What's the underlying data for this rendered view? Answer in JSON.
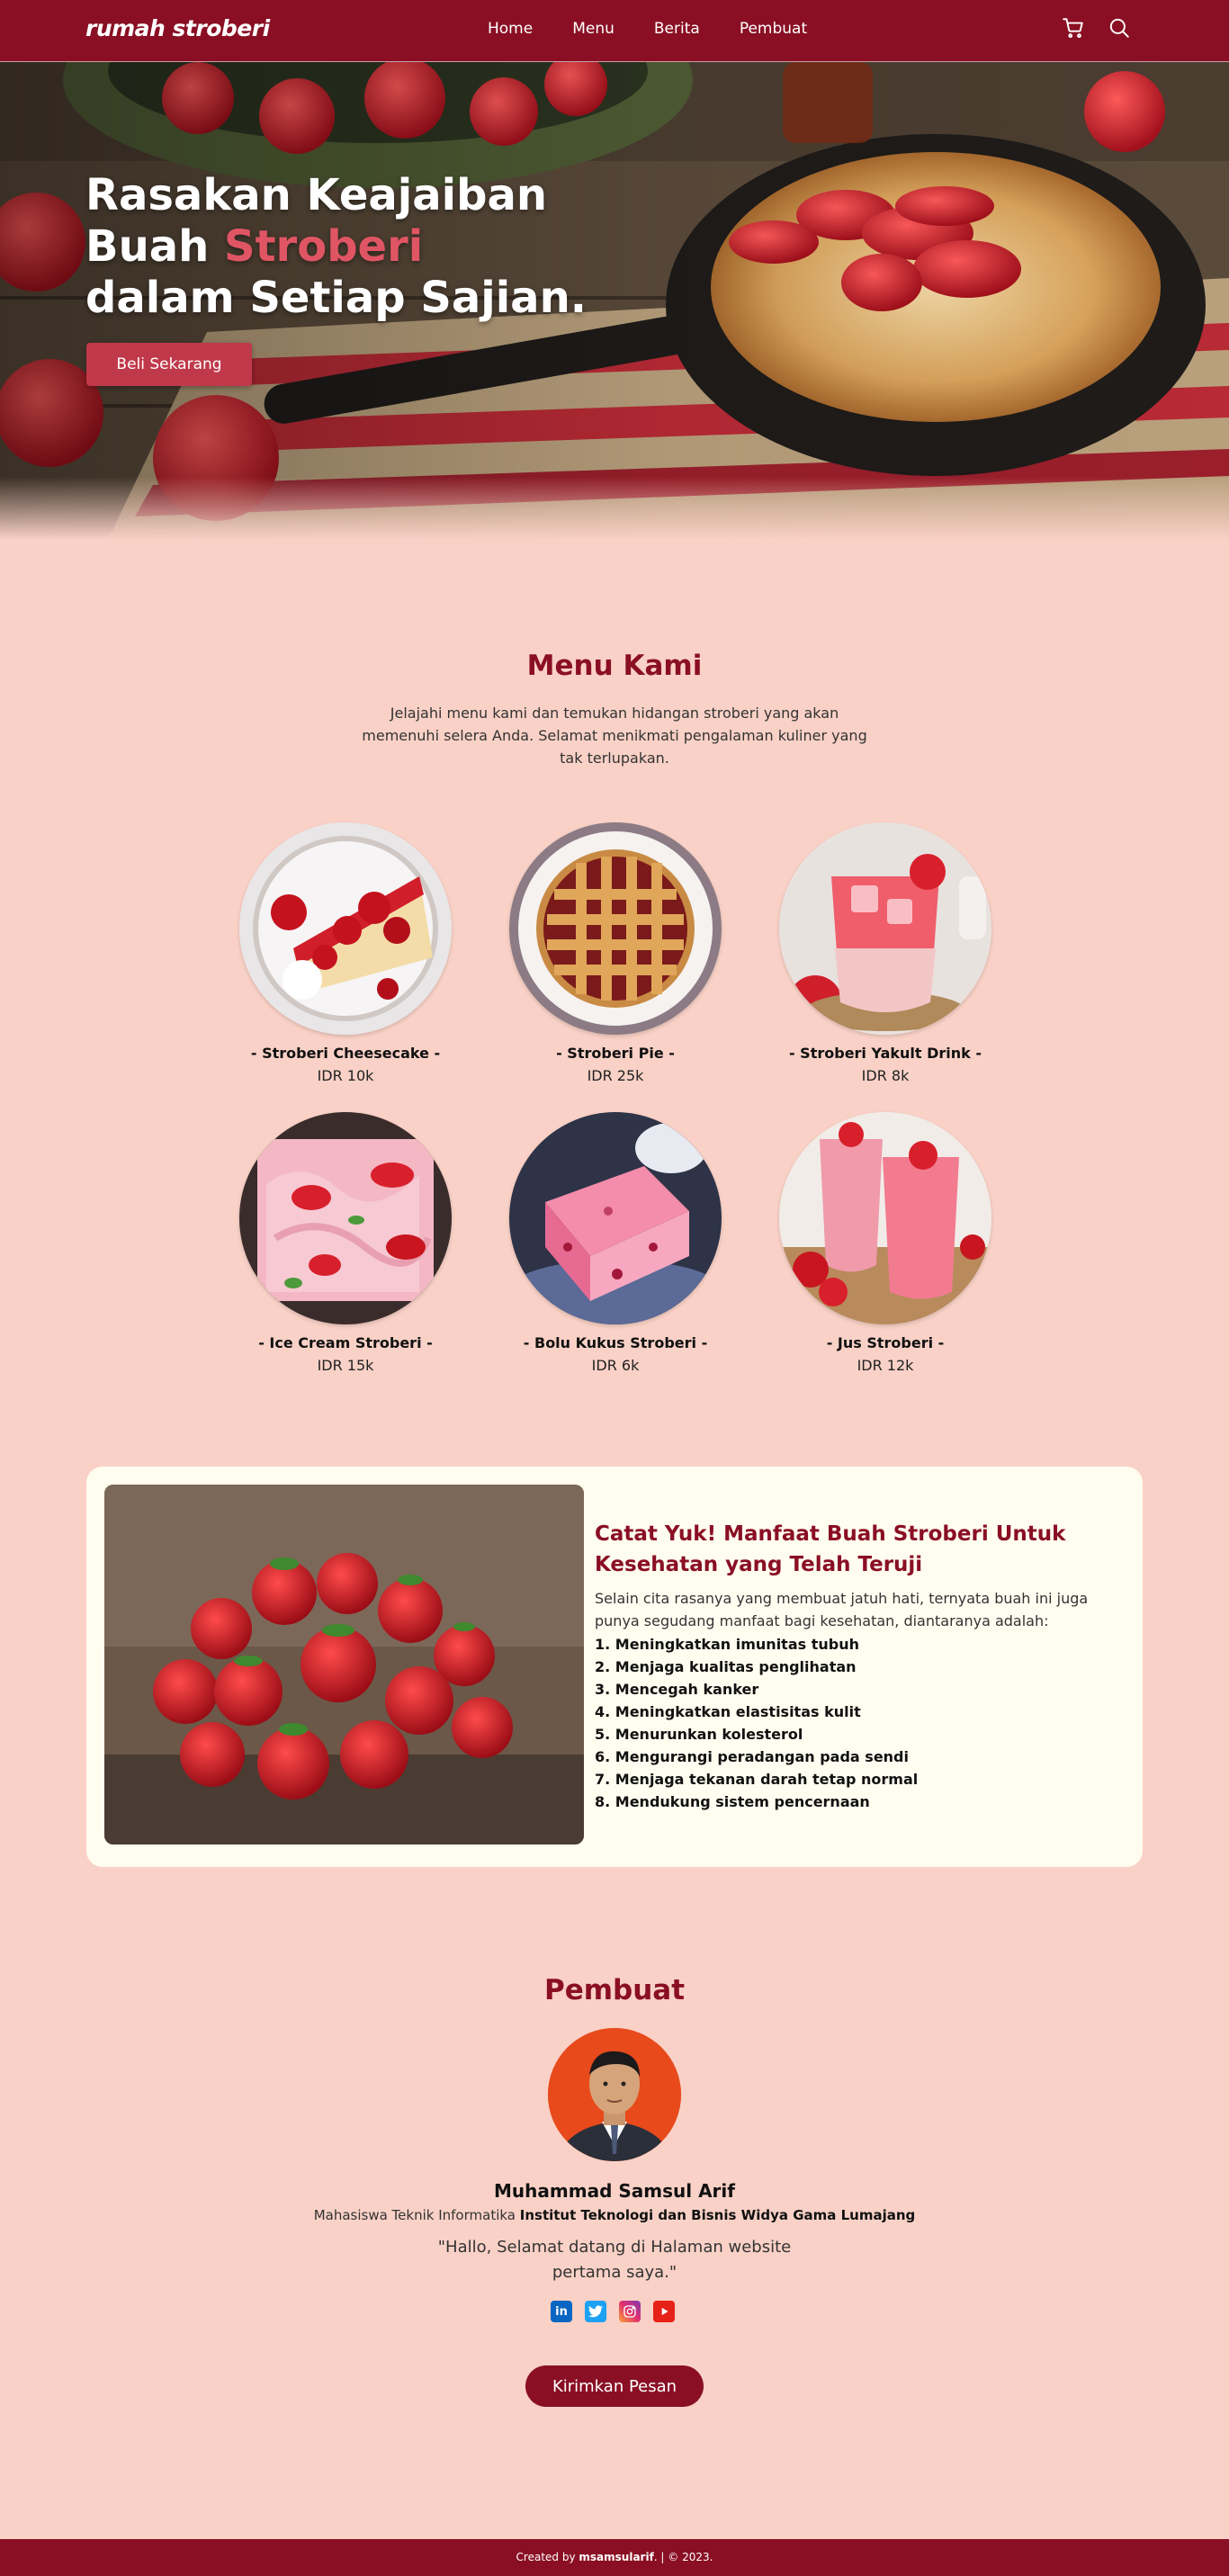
{
  "navbar": {
    "brand": "rumah stroberi",
    "links": [
      "Home",
      "Menu",
      "Berita",
      "Pembuat"
    ],
    "icons": [
      "cart-icon",
      "search-icon"
    ]
  },
  "hero": {
    "line1": "Rasakan Keajaiban",
    "line2_prefix": "Buah ",
    "line2_highlight": "Stroberi",
    "line3": "dalam Setiap Sajian.",
    "button": "Beli Sekarang"
  },
  "menu": {
    "title": "Menu Kami",
    "description": "Jelajahi menu kami dan temukan hidangan stroberi yang akan memenuhi selera Anda. Selamat menikmati pengalaman kuliner yang tak terlupakan.",
    "items": [
      {
        "name": "- Stroberi Cheesecake -",
        "price": "IDR 10k"
      },
      {
        "name": "- Stroberi Pie -",
        "price": "IDR 25k"
      },
      {
        "name": "- Stroberi Yakult Drink -",
        "price": "IDR 8k"
      },
      {
        "name": "- Ice Cream Stroberi -",
        "price": "IDR 15k"
      },
      {
        "name": "- Bolu Kukus Stroberi -",
        "price": "IDR 6k"
      },
      {
        "name": "- Jus Stroberi -",
        "price": "IDR 12k"
      }
    ]
  },
  "fact": {
    "title": "Catat Yuk! Manfaat Buah Stroberi Untuk Kesehatan yang Telah Teruji",
    "intro": "Selain cita rasanya yang membuat jatuh hati, ternyata buah ini juga punya segudang manfaat bagi kesehatan, diantaranya adalah:",
    "list": [
      "1. Meningkatkan imunitas tubuh",
      "2. Menjaga kualitas penglihatan",
      "3. Mencegah kanker",
      "4. Meningkatkan elastisitas kulit",
      "5. Menurunkan kolesterol",
      "6. Mengurangi peradangan pada sendi",
      "7. Menjaga tekanan darah tetap normal",
      "8. Mendukung sistem pencernaan"
    ]
  },
  "creator": {
    "title": "Pembuat",
    "name": "Muhammad Samsul Arif",
    "role_prefix": "Mahasiswa Teknik Informatika ",
    "role_school": "Institut Teknologi dan Bisnis Widya Gama Lumajang",
    "quote": "\"Hallo, Selamat datang di Halaman website pertama saya.\"",
    "socials": [
      "linkedin-icon",
      "twitter-icon",
      "instagram-icon",
      "youtube-icon"
    ],
    "button": "Kirimkan Pesan"
  },
  "footer": {
    "prefix": "Created by ",
    "author": "msamsularif",
    "suffix": ". | © 2023."
  },
  "colors": {
    "primary": "#8a0f24",
    "background": "#f9d1c6",
    "accent": "#c0394a",
    "card": "#fffdf0"
  }
}
